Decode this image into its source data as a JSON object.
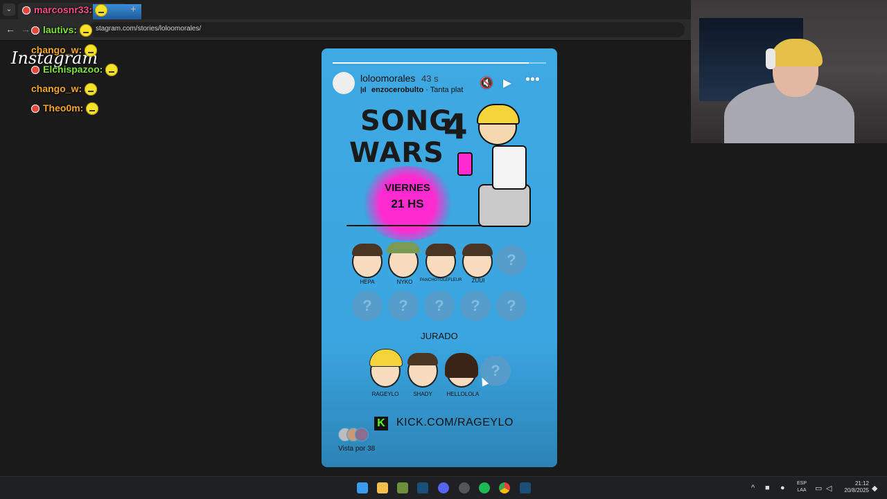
{
  "browser": {
    "url": "stagram.com/stories/loloomorales/"
  },
  "chat": [
    {
      "user": "marcosnr33:",
      "color": "pink"
    },
    {
      "user": "lautivs:",
      "color": "green"
    },
    {
      "user": "chango_w:",
      "color": "orange"
    },
    {
      "user": "Elchispazoo:",
      "color": "green"
    },
    {
      "user": "chango_w:",
      "color": "orange"
    },
    {
      "user": "Theo0m:",
      "color": "orange"
    }
  ],
  "overlay": {
    "instagram_word": "Instagram"
  },
  "story": {
    "progress": 0.92,
    "username": "loloomorales",
    "time_ago": "43 s",
    "music_artist": "enzocerobulto",
    "music_track": "Tanta plat",
    "title_line1": "SONG",
    "title_number": "4",
    "title_line2": "WARS",
    "event_day": "VIERNES",
    "event_time": "21 HS",
    "participants": [
      "HEPA",
      "NYKO",
      "PANCHOTOLEFLEUR",
      "ZUUI"
    ],
    "unknown_mark": "?",
    "jury_label": "JURADO",
    "jury": [
      "RAGEYLO",
      "SHADY",
      "HELLOLOLA"
    ],
    "kick_letter": "K",
    "kick_url": "KICK.COM/RAGEYLO",
    "viewers_text": "Vista por 38"
  },
  "taskbar": {
    "lang_line1": "ESP",
    "lang_line2": "LAA",
    "time": "21:12",
    "date": "20/8/2025"
  },
  "colors": {
    "story_bg": "#3fa9e3",
    "splat": "#ff2bd0",
    "kick_green": "#53fc18"
  }
}
